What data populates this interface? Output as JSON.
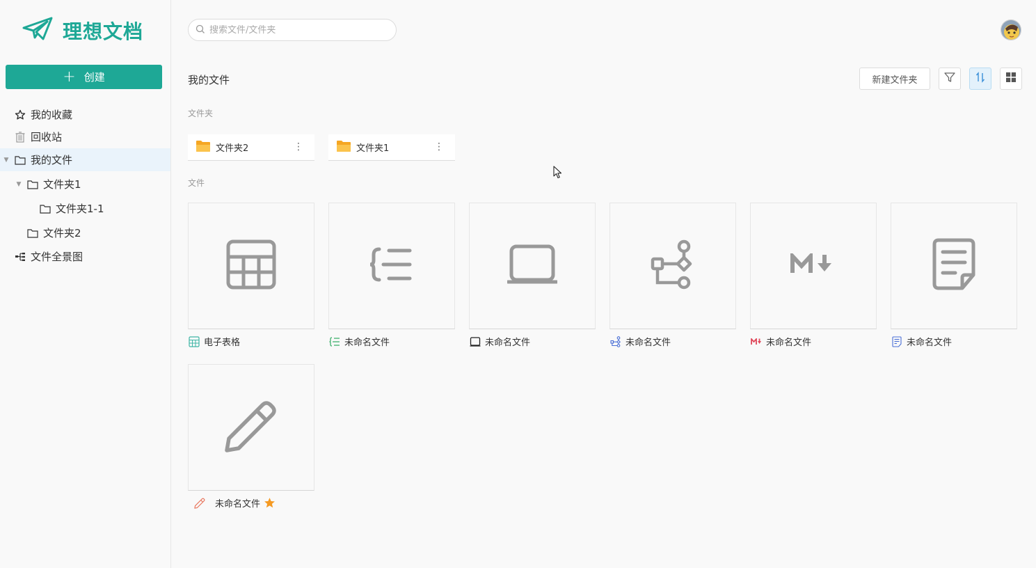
{
  "app": {
    "name": "理想文档"
  },
  "sidebar": {
    "create_label": "创建",
    "items": [
      {
        "label": "我的收藏",
        "icon": "star-icon"
      },
      {
        "label": "回收站",
        "icon": "trash-icon"
      },
      {
        "label": "我的文件",
        "icon": "folder-icon"
      },
      {
        "label": "文件夹1",
        "icon": "folder-icon"
      },
      {
        "label": "文件夹1-1",
        "icon": "folder-icon"
      },
      {
        "label": "文件夹2",
        "icon": "folder-icon"
      },
      {
        "label": "文件全景图",
        "icon": "tree-icon"
      }
    ]
  },
  "header": {
    "search_placeholder": "搜索文件/文件夹"
  },
  "main": {
    "title": "我的文件",
    "new_folder_label": "新建文件夹",
    "folders_section": "文件夹",
    "files_section": "文件",
    "folders": [
      {
        "name": "文件夹2"
      },
      {
        "name": "文件夹1"
      }
    ],
    "files": [
      {
        "name": "电子表格",
        "type": "spreadsheet",
        "icon": "table-icon"
      },
      {
        "name": "未命名文件",
        "type": "outline",
        "icon": "outline-icon"
      },
      {
        "name": "未命名文件",
        "type": "whiteboard",
        "icon": "board-icon"
      },
      {
        "name": "未命名文件",
        "type": "flowchart",
        "icon": "flowchart-icon"
      },
      {
        "name": "未命名文件",
        "type": "markdown",
        "icon": "markdown-icon"
      },
      {
        "name": "未命名文件",
        "type": "document",
        "icon": "document-icon"
      },
      {
        "name": "未命名文件",
        "type": "sketch",
        "icon": "pencil-icon",
        "starred": true
      }
    ]
  },
  "colors": {
    "brand": "#1ea896",
    "folder": "#f5a623",
    "star": "#f59a23"
  }
}
